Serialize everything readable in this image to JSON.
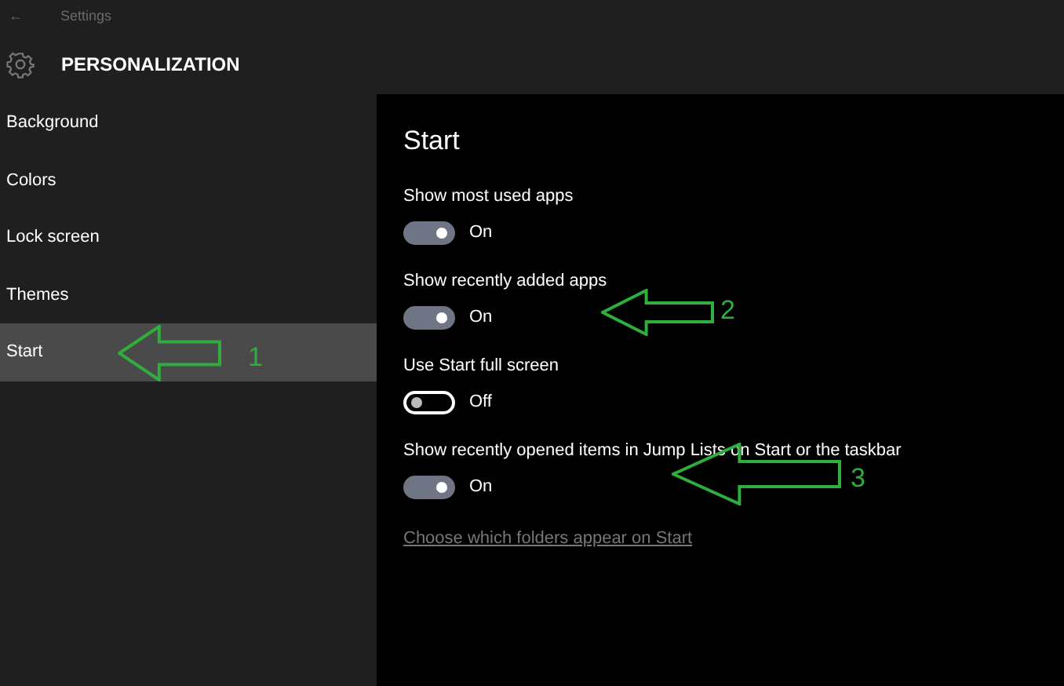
{
  "window": {
    "title": "Settings",
    "back": "←"
  },
  "header": {
    "title": "PERSONALIZATION"
  },
  "sidebar": {
    "items": [
      {
        "label": "Background",
        "selected": false
      },
      {
        "label": "Colors",
        "selected": false
      },
      {
        "label": "Lock screen",
        "selected": false
      },
      {
        "label": "Themes",
        "selected": false
      },
      {
        "label": "Start",
        "selected": true
      }
    ]
  },
  "content": {
    "title": "Start",
    "settings": [
      {
        "label": "Show most used apps",
        "on": true,
        "state_text": "On"
      },
      {
        "label": "Show recently added apps",
        "on": true,
        "state_text": "On"
      },
      {
        "label": "Use Start full screen",
        "on": false,
        "state_text": "Off"
      },
      {
        "label": "Show recently opened items in Jump Lists on Start or the taskbar",
        "on": true,
        "state_text": "On"
      }
    ],
    "link": "Choose which folders appear on Start"
  },
  "annotations": [
    {
      "number": "1"
    },
    {
      "number": "2"
    },
    {
      "number": "3"
    }
  ]
}
